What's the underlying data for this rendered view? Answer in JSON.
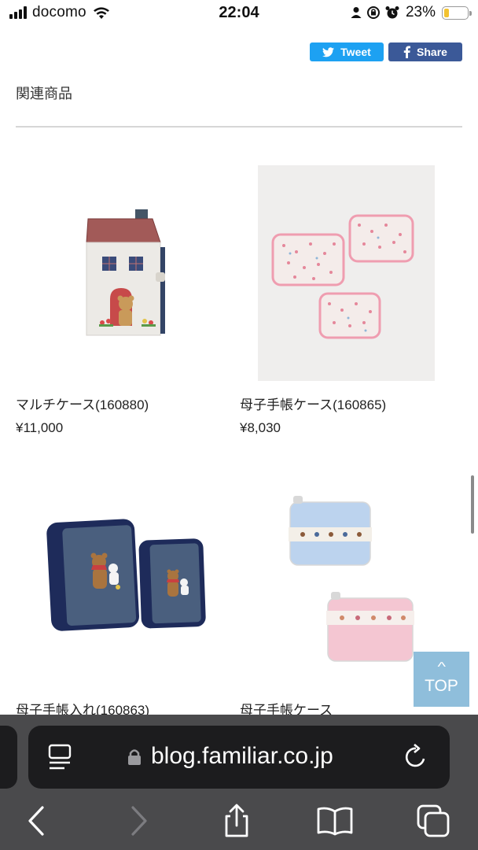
{
  "status_bar": {
    "carrier": "docomo",
    "time": "22:04",
    "battery_percent_text": "23%",
    "battery_level": 0.23
  },
  "share": {
    "tweet_label": "Tweet",
    "share_label": "Share"
  },
  "section": {
    "title": "関連商品"
  },
  "products": [
    {
      "name": "マルチケース(160880)",
      "price": "¥11,000"
    },
    {
      "name": "母子手帳ケース(160865)",
      "price": "¥8,030"
    },
    {
      "name": "母子手帳入れ(160863)",
      "price": ""
    },
    {
      "name": "母子手帳ケース",
      "price": ""
    }
  ],
  "top_button": {
    "label": "TOP"
  },
  "browser": {
    "url": "blog.familiar.co.jp"
  },
  "colors": {
    "tweet": "#1da1f2",
    "share": "#3b5998",
    "top_button": "#8fbedb",
    "safari_chrome": "#4a4a4c"
  }
}
